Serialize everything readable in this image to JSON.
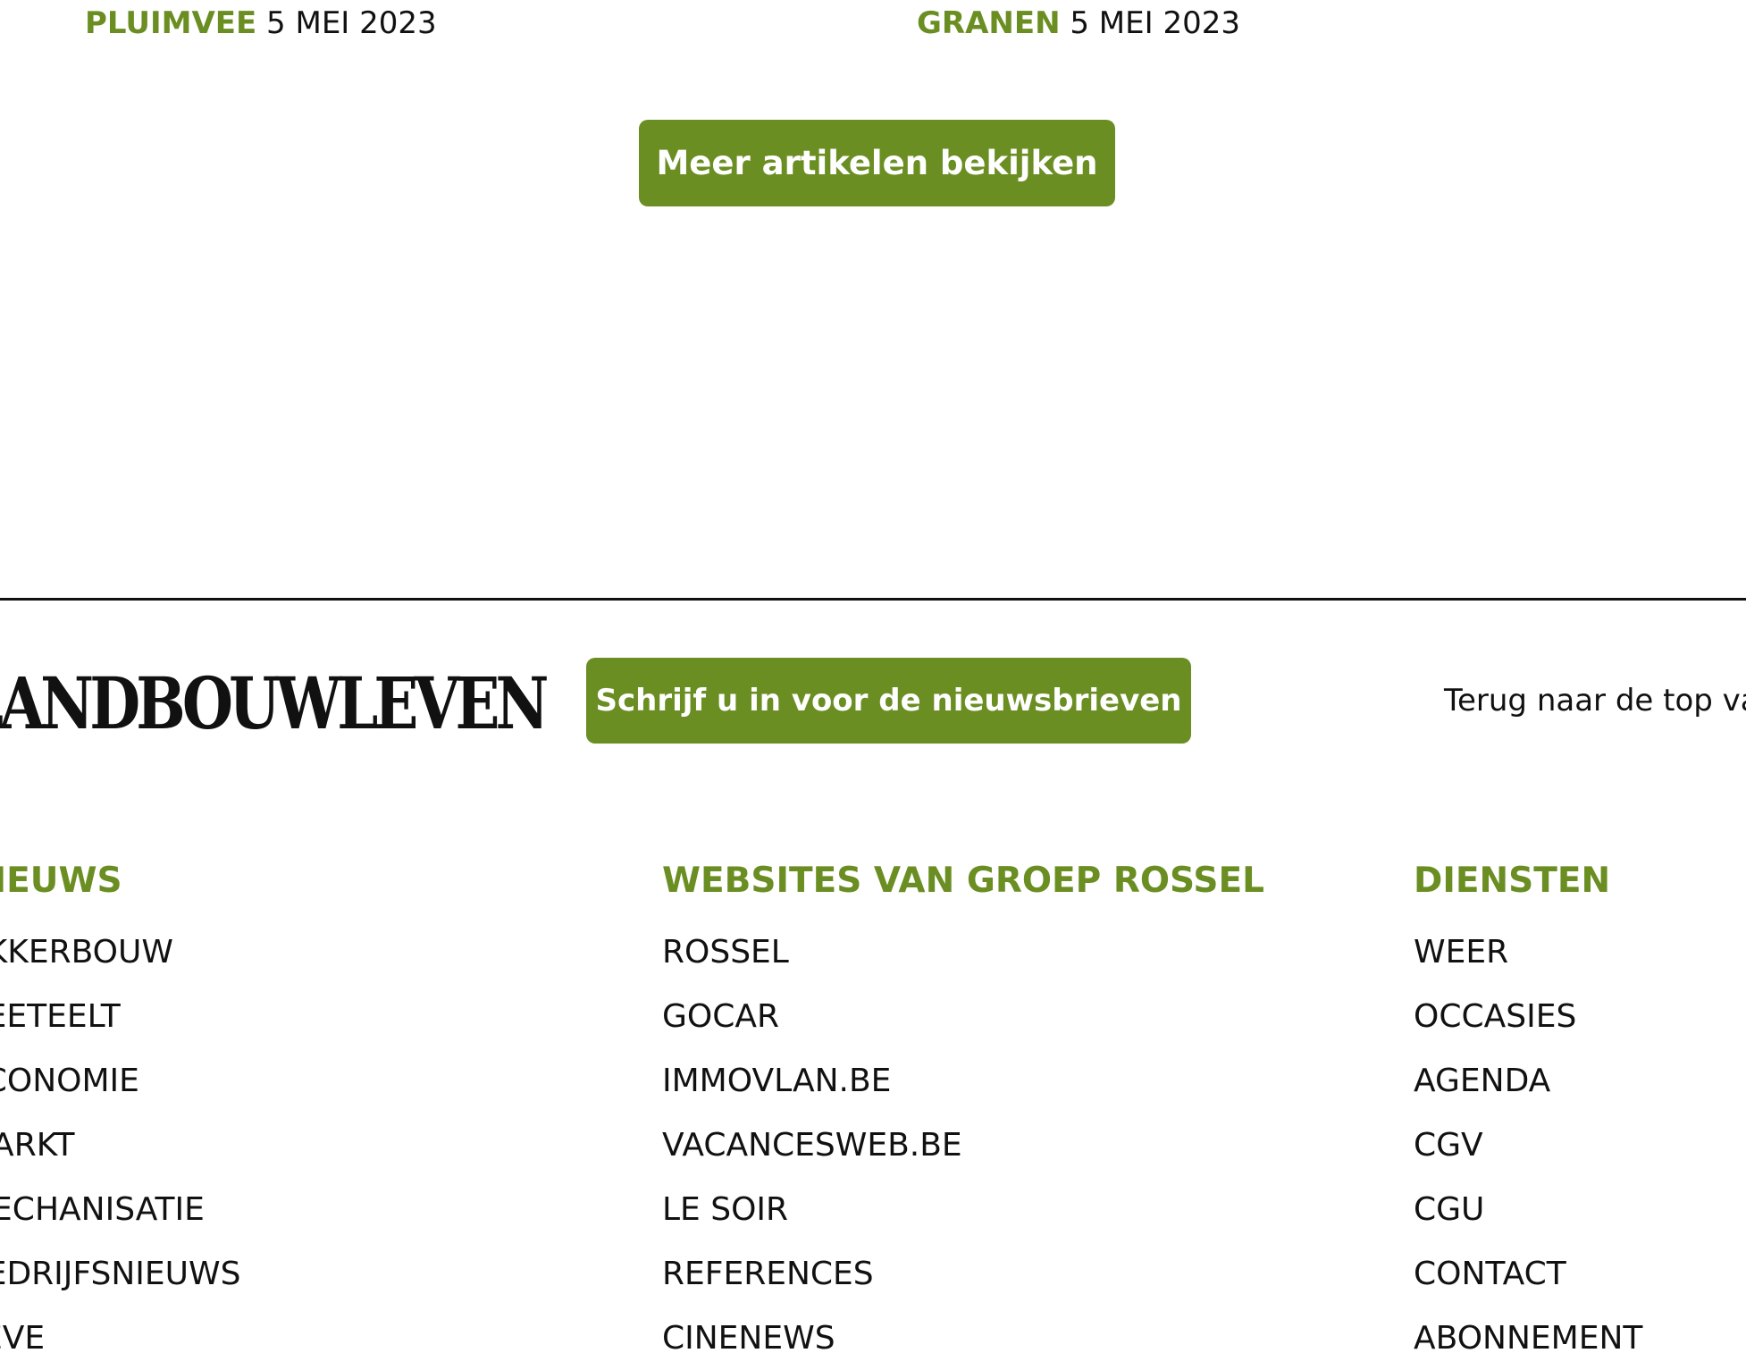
{
  "articles": [
    {
      "category": "PLUIMVEE",
      "date": "5 MEI 2023"
    },
    {
      "category": "GRANEN",
      "date": "5 MEI 2023"
    }
  ],
  "more_button_label": "Meer artikelen bekijken",
  "footer": {
    "logo_text": "LANDBOUWLEVEN",
    "newsletter_button_label": "Schrijf u in voor de nieuwsbrieven",
    "back_to_top_label": "Terug naar de top van de pagina",
    "columns": [
      {
        "heading": "NIEUWS",
        "items": [
          "AKKERBOUW",
          "VEETEELT",
          "ECONOMIE",
          "MARKT",
          "MECHANISATIE",
          "BEDRIJFSNIEUWS",
          "LEVE"
        ]
      },
      {
        "heading": "WEBSITES VAN GROEP ROSSEL",
        "items": [
          "ROSSEL",
          "GOCAR",
          "IMMOVLAN.BE",
          "VACANCESWEB.BE",
          "LE SOIR",
          "REFERENCES",
          "CINENEWS"
        ]
      },
      {
        "heading": "DIENSTEN",
        "items": [
          "WEER",
          "OCCASIES",
          "AGENDA",
          "CGV",
          "CGU",
          "CONTACT",
          "ABONNEMENT"
        ]
      }
    ]
  },
  "colors": {
    "accent": "#6b8e23",
    "text": "#111111",
    "background": "#ffffff"
  }
}
